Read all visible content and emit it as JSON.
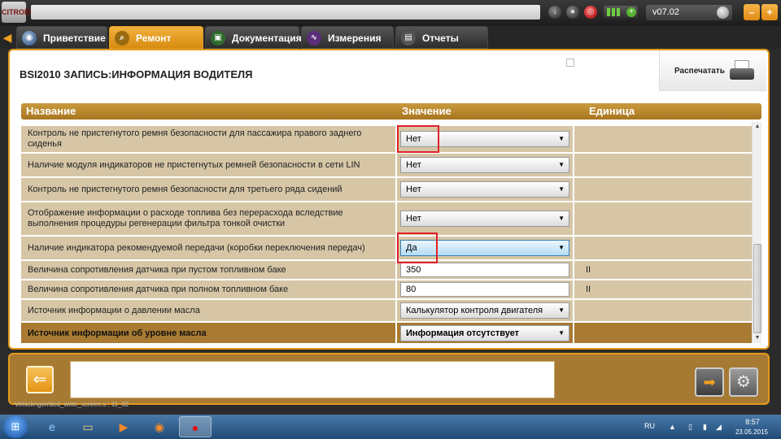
{
  "topbar": {
    "logo_text": "CITROËN",
    "version": "v07.02",
    "minimize_label": "–",
    "close_label": "+"
  },
  "tabs": [
    {
      "label": "Приветствие",
      "icon": "greeting-icon"
    },
    {
      "label": "Ремонт",
      "icon": "magnifier-icon",
      "active": true
    },
    {
      "label": "Документация",
      "icon": "documentation-icon"
    },
    {
      "label": "Измерения",
      "icon": "measurement-icon"
    },
    {
      "label": "Отчеты",
      "icon": "reports-icon"
    }
  ],
  "page": {
    "title": "BSI2010  ЗАПИСЬ:ИНФОРМАЦИЯ ВОДИТЕЛЯ",
    "print_label": "Распечатать"
  },
  "grid": {
    "columns": [
      "Название",
      "Значение",
      "Единица"
    ],
    "rows": [
      {
        "name": "Контроль не пристегнутого ремня безопасности для пассажира правого заднего сиденья",
        "value": "Нет",
        "type": "select",
        "unit": "",
        "highlight": false
      },
      {
        "name": "Наличие модуля индикаторов не пристегнутых ремней безопасности в сети LIN",
        "value": "Нет",
        "type": "select",
        "unit": ""
      },
      {
        "name": "Контроль не пристегнутого ремня безопасности для третьего ряда сидений",
        "value": "Нет",
        "type": "select",
        "unit": ""
      },
      {
        "name": "Отображение информации о расходе топлива без перерасхода вследствие выполнения процедуры регенерации фильтра тонкой очистки",
        "value": "Нет",
        "type": "select",
        "unit": ""
      },
      {
        "name": "Наличие индикатора рекомендуемой передачи (коробки переключения передач)",
        "value": "Да",
        "type": "select",
        "unit": "",
        "highlight": true
      },
      {
        "name": "Величина сопротивления датчика при пустом топливном баке",
        "value": "350",
        "type": "input",
        "unit": "II"
      },
      {
        "name": "Величина сопротивления датчика при полном топливном баке",
        "value": "80",
        "type": "input",
        "unit": "II"
      },
      {
        "name": "Источник информации о давлении масла",
        "value": "Калькулятор контроля двигателя",
        "type": "select",
        "unit": ""
      },
      {
        "name": "Источник информации об уровне масла",
        "value": "Информация отсутствует",
        "type": "select",
        "unit": "",
        "selected_row": true
      }
    ]
  },
  "bottom": {
    "path": "Vehicle\\gen\\tlcd_write_screen.s : 11_02"
  },
  "taskbar": {
    "language": "RU",
    "time": "8:57",
    "date": "23.05.2015"
  },
  "colors": {
    "accent": "#e49a1c",
    "row_bg": "#d6c6a6",
    "row_dark": "#a87a32",
    "highlight_box": "#e0222a"
  }
}
